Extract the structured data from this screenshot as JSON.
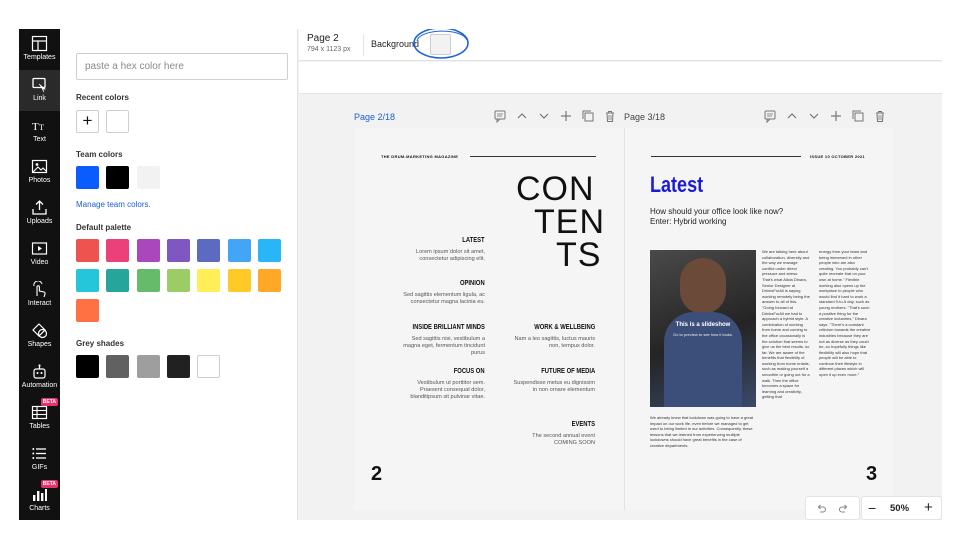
{
  "rail": {
    "items": [
      {
        "label": "Templates",
        "icon": "templates-icon"
      },
      {
        "label": "Link",
        "icon": "link-icon"
      },
      {
        "label": "Text",
        "icon": "text-icon"
      },
      {
        "label": "Photos",
        "icon": "photos-icon"
      },
      {
        "label": "Uploads",
        "icon": "uploads-icon"
      },
      {
        "label": "Video",
        "icon": "video-icon"
      },
      {
        "label": "Interact",
        "icon": "interact-icon"
      },
      {
        "label": "Shapes",
        "icon": "shapes-icon"
      },
      {
        "label": "Automation",
        "icon": "automation-icon"
      },
      {
        "label": "Tables",
        "icon": "tables-icon",
        "badge": "BETA"
      },
      {
        "label": "GIFs",
        "icon": "gifs-icon"
      },
      {
        "label": "Charts",
        "icon": "charts-icon",
        "badge": "BETA"
      }
    ],
    "active": "Link"
  },
  "panel": {
    "hex_placeholder": "paste a hex color here",
    "recent_title": "Recent colors",
    "recent_colors": [
      "#ffffff"
    ],
    "team_title": "Team colors",
    "team_colors": [
      "#0b5cff",
      "#000000",
      "#f2f2f2"
    ],
    "manage_link": "Manage team colors.",
    "default_title": "Default palette",
    "default_palette": [
      "#ef5350",
      "#ec407a",
      "#ab47bc",
      "#7e57c2",
      "#5c6bc0",
      "#42a5f5",
      "#29b6f6",
      "#26c6da",
      "#26a69a",
      "#66bb6a",
      "#9ccc65",
      "#ffee58",
      "#ffca28",
      "#ffa726",
      "#ff7043"
    ],
    "grey_title": "Grey shades",
    "grey_shades": [
      "#000000",
      "#616161",
      "#9e9e9e",
      "#212121",
      "#ffffff"
    ]
  },
  "topbar": {
    "page_name": "Page 2",
    "page_dims": "794 x 1123 px",
    "background_label": "Background",
    "background_color": "#f2f2f3"
  },
  "pages": {
    "left_label": "Page 2/18",
    "right_label": "Page 3/18",
    "active_color": "#1a5fd0"
  },
  "magazine": {
    "left": {
      "header": "THE DRUM-MARKETING MAGAZINE",
      "contents": [
        "CON",
        "TEN",
        "TS"
      ],
      "sections_left": [
        {
          "title": "LATEST",
          "text": "Lorem ipsum dolor sit amet, consectetur adipiscing elit."
        },
        {
          "title": "OPINION",
          "text": "Sed sagittis elementum ligula, ac consectetur magna lacinia eu."
        },
        {
          "title": "INSIDE BRILLIANT MINDS",
          "text": "Sed sagittis nisi, vestibulum a magna eget, fermentum tincidunt purus"
        },
        {
          "title": "FOCUS ON",
          "text": "Vestibulum ut porttitor sem. Praesent consequat dolor, blanditipsum sit pulvinar vitae."
        }
      ],
      "sections_right": [
        {
          "title": "WORK & WELLBEING",
          "text": "Nam a leo sagittis, luctus mauris non, tempus dolor."
        },
        {
          "title": "FUTURE OF MEDIA",
          "text": "Suspendisse metus eu dignissim in non ornare elementum"
        },
        {
          "title": "EVENTS",
          "text": "The second annual event COMING SOON"
        }
      ],
      "page_number": "2"
    },
    "right": {
      "issue": "ISSUE 10 OCTOBER 2021",
      "title": "Latest",
      "title_color": "#1b1bd6",
      "subtitle": "How should your office look like now? Enter: Hybrid working",
      "slideshow_title": "This is a slideshow",
      "slideshow_hint": "Go to preview to see how it looks.",
      "col1": "We are talking here about collaboration, diversity and the way we manage conflict under direct pressure and stress. That's what Alicia Dinara, Senior Designer at DrinksForAll is saying working remotely being the answer to all of this. \"Going forward at DrinksForAll we had to approach a hybrid style. A combination of working from home and coming to the office occasionally is the solution that seems to give us the best results, so far. We are aware of the benefits that flexibility of working from home entails, such as making yourself a smoothie or going out for a walk. Then the office becomes a space for learning and creativity, getting that",
      "col2": "energy from your team and being immersed in other people who are also creating. You probably can't quite recreate that on your own at home.\" Flexible working also opens up the workplace to people who would find it hard to work a standard 9-to-5 day, such as young mothers. \"That's such a positive thing for the creative industries,\" Dinara says. \"There's a constant criticism towards the creative industries because they are not as diverse as they could be, so hopefully things like flexibility will also hope that people will be able to continue their lifestyle in different places which will open it up even more.\"",
      "bottom": "We already knew that lockdown was going to have a great impact on our work life, even before we managed to get used to being limited in our activities. Consequently, these lessons that we learned from experiencing multiple lockdowns should have great benefits in the case of creative departments.",
      "page_number": "3"
    }
  },
  "zoom": {
    "value": "50%",
    "minus": "−",
    "plus": "+"
  }
}
